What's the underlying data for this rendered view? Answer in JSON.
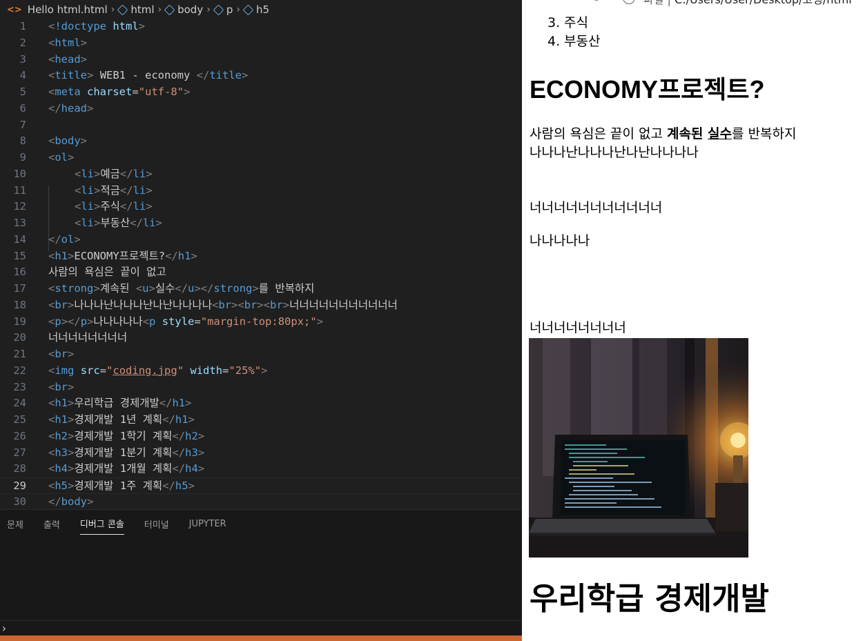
{
  "editor": {
    "breadcrumb": [
      "Hello html.html",
      "html",
      "body",
      "p",
      "h5"
    ],
    "active_line": 29,
    "lines": [
      {
        "num": "1"
      },
      {
        "num": "2"
      },
      {
        "num": "3"
      },
      {
        "num": "4"
      },
      {
        "num": "5"
      },
      {
        "num": "6"
      },
      {
        "num": "7"
      },
      {
        "num": "8"
      },
      {
        "num": "9"
      },
      {
        "num": "10"
      },
      {
        "num": "11"
      },
      {
        "num": "12"
      },
      {
        "num": "13"
      },
      {
        "num": "14"
      },
      {
        "num": "15"
      },
      {
        "num": "16"
      },
      {
        "num": "17"
      },
      {
        "num": "18"
      },
      {
        "num": "19"
      },
      {
        "num": "20"
      },
      {
        "num": "21"
      },
      {
        "num": "22"
      },
      {
        "num": "23"
      },
      {
        "num": "24"
      },
      {
        "num": "25"
      },
      {
        "num": "26"
      },
      {
        "num": "27"
      },
      {
        "num": "28"
      },
      {
        "num": "29"
      },
      {
        "num": "30"
      }
    ],
    "code": {
      "doctype": "html",
      "title_text": " WEB1 - economy ",
      "charset_value": "\"utf-8\"",
      "li_items": [
        "예금",
        "적금",
        "주식",
        "부동산"
      ],
      "h1_text": "ECONOMY프로젝트?",
      "line16": "사람의 욕심은 끝이 없고",
      "line17_strong": "계속된 ",
      "line17_u": "실수",
      "line17_after": "를 반복하지",
      "line18_a": "나나나난나나나난나난나나나나",
      "line18_b": "너너너너너너너너너너너",
      "line19_text": "나나나나나",
      "line19_style": "\"margin-top:80px;\"",
      "line20": "너너너너너너너너",
      "img_src": "coding.jpg",
      "img_width": "\"25%\"",
      "h1_a": "우리학급 경제개발",
      "h1_b": "경제개발 1년 계획",
      "h2": "경제개발 1학기 계획",
      "h3": "경제개발 1분기 계획",
      "h4": "경제개발 1개월 계획",
      "h5": "경제개발 1주 계획"
    }
  },
  "panel": {
    "tabs": [
      "문제",
      "출력",
      "디버그 콘솔",
      "터미널",
      "JUPYTER"
    ],
    "active_tab": "디버그 콘솔",
    "prompt": "›"
  },
  "browser": {
    "url_label": "파일",
    "url_path": "C:/Users/User/Desktop/코딩/html",
    "list_items": [
      {
        "num": "3.",
        "text": "주식"
      },
      {
        "num": "4.",
        "text": "부동산"
      }
    ],
    "heading": "ECONOMY프로젝트?",
    "para1_before": "사람의 욕심은 끝이 없고 ",
    "para1_strong": "계속된 ",
    "para1_u": "실수",
    "para1_after": "를 반복하지",
    "para1_line2": "나나나난나나나난나난나나나나",
    "para2": "너너너너너너너너너너너",
    "para3": "나나나나나",
    "para4": "너너너너너너너너",
    "image_alt": "coding.jpg",
    "heading2": "우리학급 경제개발"
  }
}
